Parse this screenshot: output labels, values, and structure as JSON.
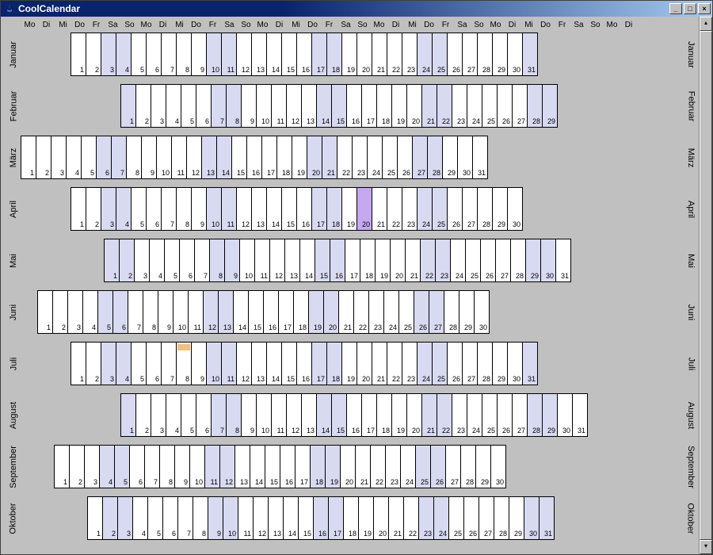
{
  "window": {
    "title": "CoolCalendar"
  },
  "weekdays": [
    "Mo",
    "Di",
    "Mi",
    "Do",
    "Fr",
    "Sa",
    "So",
    "Mo",
    "Di",
    "Mi",
    "Do",
    "Fr",
    "Sa",
    "So",
    "Mo",
    "Di",
    "Mi",
    "Do",
    "Fr",
    "Sa",
    "So",
    "Mo",
    "Di",
    "Mi",
    "Do",
    "Fr",
    "Sa",
    "So",
    "Mo",
    "Di",
    "Mi",
    "Do",
    "Fr",
    "Sa",
    "So",
    "Mo",
    "Di"
  ],
  "months": [
    {
      "name": "Januar",
      "offset": 3,
      "days": 31
    },
    {
      "name": "Februar",
      "offset": 6,
      "days": 29
    },
    {
      "name": "März",
      "offset": 0,
      "days": 31
    },
    {
      "name": "April",
      "offset": 3,
      "days": 30,
      "today": 20
    },
    {
      "name": "Mai",
      "offset": 5,
      "days": 31
    },
    {
      "name": "Juni",
      "offset": 1,
      "days": 30
    },
    {
      "name": "Juli",
      "offset": 3,
      "days": 31,
      "marks": [
        8
      ]
    },
    {
      "name": "August",
      "offset": 6,
      "days": 31
    },
    {
      "name": "September",
      "offset": 2,
      "days": 30
    },
    {
      "name": "Oktober",
      "offset": 4,
      "days": 31
    }
  ],
  "colors": {
    "weekend": "#d8daf2",
    "today": "#c6a8f0",
    "mark": "#f0c080",
    "background": "#c0c0c0"
  }
}
